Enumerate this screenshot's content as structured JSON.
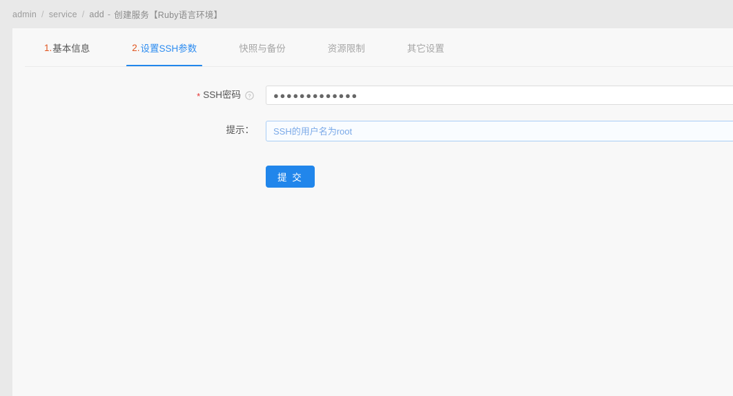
{
  "breadcrumb": {
    "items": [
      "admin",
      "service",
      "add"
    ],
    "separator": "/",
    "dash": "-",
    "title": "创建服务【Ruby语言环境】"
  },
  "tabs": [
    {
      "num": "1.",
      "label": "基本信息",
      "state": "visited"
    },
    {
      "num": "2.",
      "label": "设置SSH参数",
      "state": "active"
    },
    {
      "num": "",
      "label": "快照与备份",
      "state": "inactive"
    },
    {
      "num": "",
      "label": "资源限制",
      "state": "inactive"
    },
    {
      "num": "",
      "label": "其它设置",
      "state": "inactive"
    }
  ],
  "form": {
    "fields": [
      {
        "required_mark": "*",
        "label": "SSH密码",
        "help_icon": "question-circle-icon",
        "value": "●●●●●●●●●●●●●",
        "placeholder": ""
      },
      {
        "required_mark": "",
        "label": "提示：",
        "help_icon": "",
        "value": "",
        "placeholder": "SSH的用户名为root"
      }
    ],
    "submit_label": "提 交"
  },
  "colors": {
    "accent_blue": "#2186eb",
    "tab_number_orange": "#e0551f",
    "required_red": "#e63232",
    "hint_blue": "#7aa9e8",
    "page_background": "#e9e9e9",
    "card_background": "#f8f8f8"
  }
}
